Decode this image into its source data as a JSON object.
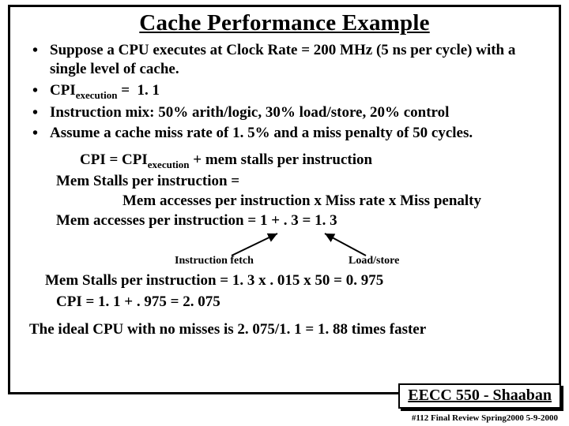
{
  "title": "Cache Performance Example",
  "bullets": [
    "Suppose a CPU executes at Clock Rate = 200 MHz (5 ns per cycle) with a single level of cache.",
    "CPI|execution|  =  1. 1",
    "Instruction mix:   50% arith/logic,  30% load/store, 20% control",
    "Assume a cache miss rate of 1. 5% and a miss penalty of 50 cycles."
  ],
  "formula": {
    "line1_a": "CPI =   CPI",
    "line1_sub": "execution",
    "line1_b": "  +   mem stalls per instruction",
    "line2": "Mem Stalls per instruction =",
    "line3": "Mem accesses per instruction  x  Miss rate x Miss penalty",
    "line4": "Mem accesses per instruction =  1  +   . 3   =  1. 3"
  },
  "arrow_labels": {
    "left": "Instruction fetch",
    "right": "Load/store"
  },
  "results": {
    "line1": "Mem Stalls per instruction  =  1. 3 x  . 015 x 50  =   0. 975",
    "line2": "CPI =  1. 1  +  . 975 =   2. 075"
  },
  "conclusion": "The ideal CPU with no misses is  2. 075/1. 1 =  1. 88 times faster",
  "corner": "EECC 550 - Shaaban",
  "footer": "#112  Final Review   Spring2000  5-9-2000"
}
